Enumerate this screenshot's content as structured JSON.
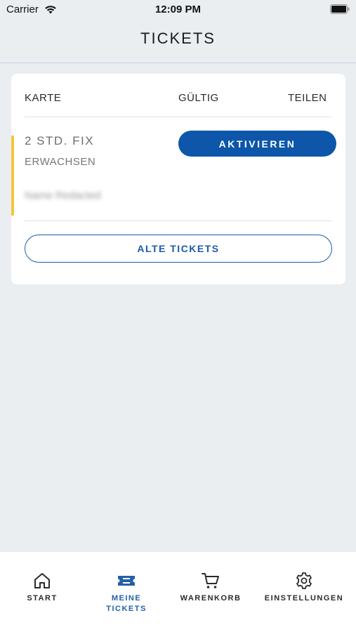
{
  "status_bar": {
    "carrier": "Carrier",
    "time": "12:09 PM"
  },
  "header": {
    "title": "TICKETS"
  },
  "card": {
    "columns": [
      "KARTE",
      "GÜLTIG",
      "TEILEN"
    ],
    "ticket": {
      "name": "2 STD. FIX",
      "type": "ERWACHSEN",
      "holder": "Name Redacted",
      "accent_color": "#f6c53a"
    },
    "activate_label": "AKTIVIEREN",
    "old_tickets_label": "ALTE TICKETS"
  },
  "tabbar": {
    "items": [
      {
        "label": "START",
        "icon": "home-icon",
        "active": false
      },
      {
        "label": "MEINE TICKETS",
        "icon": "ticket-icon",
        "active": true
      },
      {
        "label": "WARENKORB",
        "icon": "cart-icon",
        "active": false
      },
      {
        "label": "EINSTELLUNGEN",
        "icon": "gear-icon",
        "active": false
      }
    ]
  },
  "colors": {
    "accent": "#0d56aa",
    "background": "#eaeef0"
  }
}
